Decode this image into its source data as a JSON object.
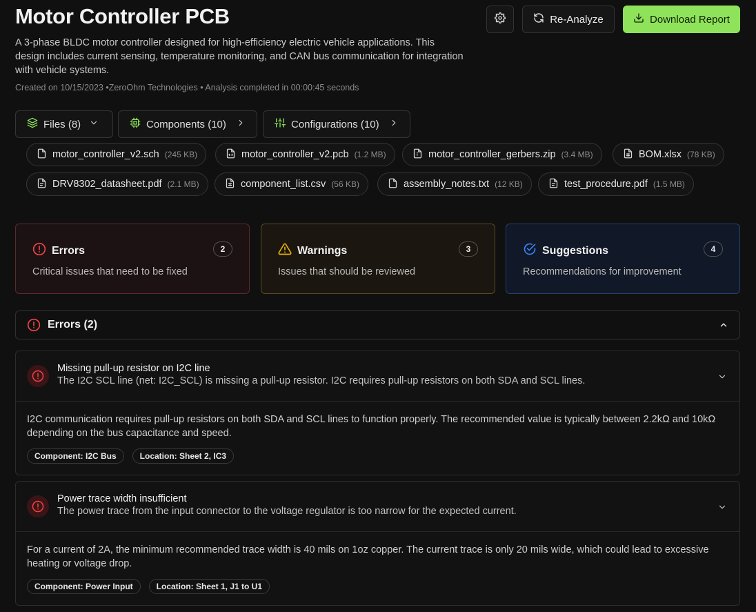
{
  "header": {
    "title": "Motor Controller PCB",
    "description": "A 3-phase BLDC motor controller designed for high-efficiency electric vehicle applications. This design includes current sensing, temperature monitoring, and CAN bus communication for integration with vehicle systems.",
    "meta": "Created on 10/15/2023 •ZeroOhm Technologies • Analysis completed in 00:00:45 seconds"
  },
  "actions": {
    "settings_icon": "gear-icon",
    "reanalyze_label": "Re-Analyze",
    "download_label": "Download Report",
    "download_color": "#8fe35a"
  },
  "tabs": [
    {
      "label": "Files (8)",
      "icon": "layers-icon"
    },
    {
      "label": "Components (10)",
      "icon": "chip-icon"
    },
    {
      "label": "Configurations (10)",
      "icon": "sliders-icon"
    }
  ],
  "files": [
    {
      "name": "motor_controller_v2.sch",
      "size": "(245 KB)"
    },
    {
      "name": "motor_controller_v2.pcb",
      "size": "(1.2 MB)"
    },
    {
      "name": "motor_controller_gerbers.zip",
      "size": "(3.4 MB)"
    },
    {
      "name": "BOM.xlsx",
      "size": "(78 KB)"
    },
    {
      "name": "DRV8302_datasheet.pdf",
      "size": "(2.1 MB)"
    },
    {
      "name": "component_list.csv",
      "size": "(56 KB)"
    },
    {
      "name": "assembly_notes.txt",
      "size": "(12 KB)"
    },
    {
      "name": "test_procedure.pdf",
      "size": "(1.5 MB)"
    }
  ],
  "summary": {
    "errors": {
      "title": "Errors",
      "desc": "Critical issues that need to be fixed",
      "count": "2",
      "color": "#ef4444"
    },
    "warnings": {
      "title": "Warnings",
      "desc": "Issues that should be reviewed",
      "count": "3",
      "color": "#eab308"
    },
    "suggestions": {
      "title": "Suggestions",
      "desc": "Recommendations for improvement",
      "count": "4",
      "color": "#3b82f6"
    }
  },
  "errors_section": {
    "title": "Errors (2)",
    "issues": [
      {
        "title": "Missing pull-up resistor on I2C line",
        "summary": "The I2C SCL line (net: I2C_SCL) is missing a pull-up resistor. I2C requires pull-up resistors on both SDA and SCL lines.",
        "detail": "I2C communication requires pull-up resistors on both SDA and SCL lines to function properly. The recommended value is typically between 2.2kΩ and 10kΩ depending on the bus capacitance and speed.",
        "component": "Component: I2C Bus",
        "location": "Location: Sheet 2, IC3"
      },
      {
        "title": "Power trace width insufficient",
        "summary": "The power trace from the input connector to the voltage regulator is too narrow for the expected current.",
        "detail": "For a current of 2A, the minimum recommended trace width is 40 mils on 1oz copper. The current trace is only 20 mils wide, which could lead to excessive heating or voltage drop.",
        "component": "Component: Power Input",
        "location": "Location: Sheet 1, J1 to U1"
      }
    ]
  }
}
